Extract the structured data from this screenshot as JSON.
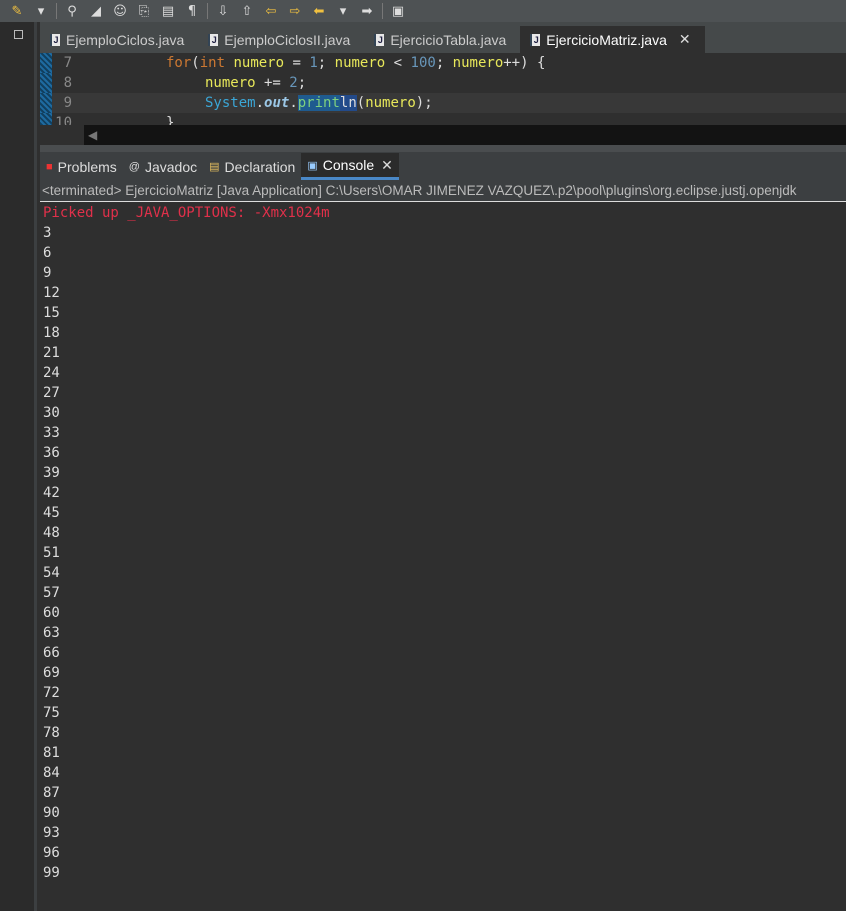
{
  "toolbar": {
    "icons": [
      "pencil-icon",
      "dropdown-icon",
      "toggle-breadcrumb-icon",
      "mark-occurrences-icon",
      "block-selection-icon",
      "word-wrap-icon",
      "show-whitespace-icon",
      "pilcrow-icon",
      "next-annotation-icon",
      "previous-annotation-icon",
      "last-edit-icon",
      "back-icon",
      "forward-icon",
      "open-perspective-icon"
    ]
  },
  "editor": {
    "tabs": [
      {
        "label": "EjemploCiclos.java"
      },
      {
        "label": "EjemploCiclosII.java"
      },
      {
        "label": "EjercicioTabla.java"
      },
      {
        "label": "EjercicioMatriz.java",
        "active": true
      }
    ],
    "lines": [
      {
        "num": "7"
      },
      {
        "num": "8"
      },
      {
        "num": "9"
      },
      {
        "num": "10"
      }
    ],
    "code": {
      "l7": {
        "kw": "for",
        "p1": "(",
        "type": "int",
        "v1": "numero",
        "op1": " = ",
        "n1": "1",
        "p2": "; ",
        "v2": "numero",
        "op2": " < ",
        "n2": "100",
        "p3": "; ",
        "v3": "numero",
        "p4": "++) {"
      },
      "l8": {
        "v": "numero",
        "op": " += ",
        "n": "2",
        "p": ";"
      },
      "l9": {
        "cls": "System",
        "dot1": ".",
        "fld": "out",
        "dot2": ".",
        "m1": "print",
        "m2": "ln",
        "p1": "(",
        "v": "numero",
        "p2": ");"
      },
      "l10": {
        "t": "}"
      }
    }
  },
  "views": {
    "tabs": [
      {
        "label": "Problems"
      },
      {
        "label": "Javadoc"
      },
      {
        "label": "Declaration"
      },
      {
        "label": "Console",
        "active": true
      }
    ]
  },
  "console": {
    "status": "<terminated> EjercicioMatriz [Java Application] C:\\Users\\OMAR JIMENEZ VAZQUEZ\\.p2\\pool\\plugins\\org.eclipse.justj.openjdk",
    "error_line": "Picked up _JAVA_OPTIONS: -Xmx1024m",
    "output": [
      "3",
      "6",
      "9",
      "12",
      "15",
      "18",
      "21",
      "24",
      "27",
      "30",
      "33",
      "36",
      "39",
      "42",
      "45",
      "48",
      "51",
      "54",
      "57",
      "60",
      "63",
      "66",
      "69",
      "72",
      "75",
      "78",
      "81",
      "84",
      "87",
      "90",
      "93",
      "96",
      "99"
    ],
    "colors": {
      "error": "#e0304a",
      "active_tab_underline": "#4a88c7"
    }
  }
}
